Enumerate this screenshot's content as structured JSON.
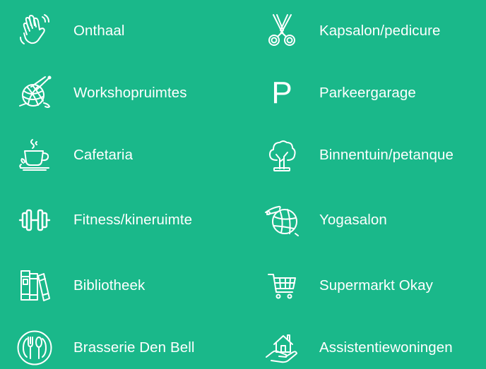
{
  "theme": {
    "background": "#1ab88a",
    "foreground": "#ffffff"
  },
  "facilities": {
    "left": [
      {
        "label": "Onthaal",
        "icon": "waving-hand-icon"
      },
      {
        "label": "Workshopruimtes",
        "icon": "yarn-ball-icon"
      },
      {
        "label": "Cafetaria",
        "icon": "coffee-cup-icon"
      },
      {
        "label": "Fitness/kineruimte",
        "icon": "dumbbell-icon"
      },
      {
        "label": "Bibliotheek",
        "icon": "books-icon"
      },
      {
        "label": "Brasserie Den Bell",
        "icon": "plate-cutlery-icon"
      }
    ],
    "right": [
      {
        "label": "Kapsalon/pedicure",
        "icon": "scissors-icon"
      },
      {
        "label": "Parkeergarage",
        "icon": "parking-icon",
        "glyph": "P"
      },
      {
        "label": "Binnentuin/petanque",
        "icon": "tree-icon"
      },
      {
        "label": "Yogasalon",
        "icon": "yoga-ball-icon"
      },
      {
        "label": "Supermarkt Okay",
        "icon": "shopping-cart-icon"
      },
      {
        "label": "Assistentiewoningen",
        "icon": "house-in-hand-icon"
      }
    ]
  }
}
